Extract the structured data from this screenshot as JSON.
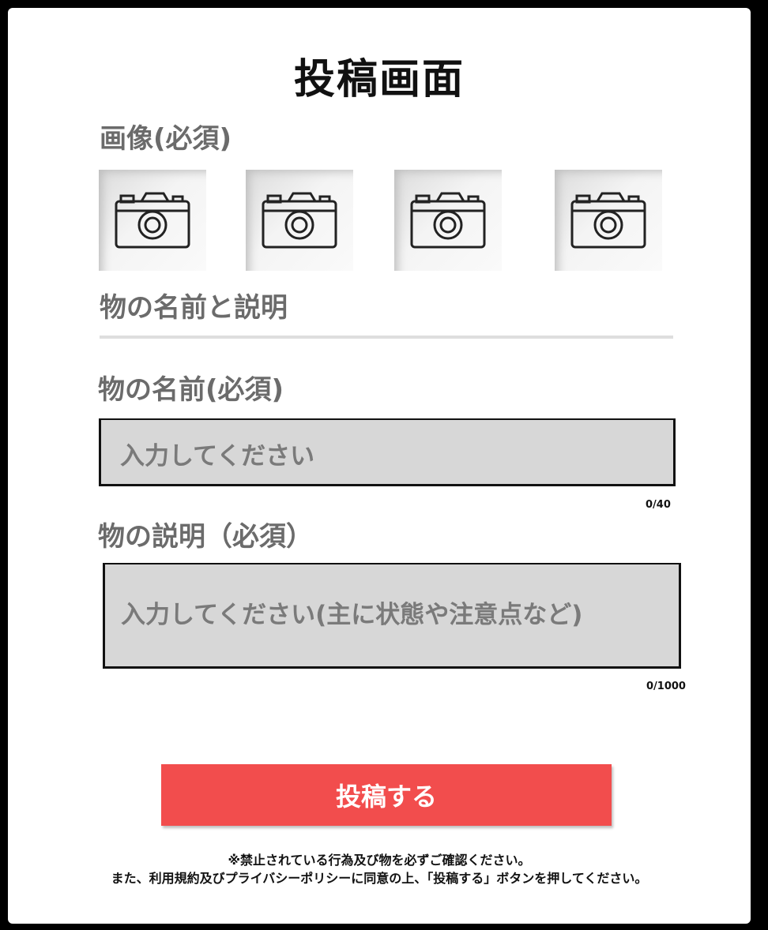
{
  "page": {
    "title": "投稿画面"
  },
  "images_section": {
    "label": "画像(必須)",
    "slots": [
      {
        "icon": "camera-icon"
      },
      {
        "icon": "camera-icon"
      },
      {
        "icon": "camera-icon"
      },
      {
        "icon": "camera-icon"
      }
    ]
  },
  "details_section": {
    "label": "物の名前と説明"
  },
  "name_field": {
    "label": "物の名前(必須)",
    "placeholder": "入力してください",
    "counter": "0/40"
  },
  "description_field": {
    "label": "物の説明（必須）",
    "placeholder": "入力してください(主に状態や注意点など)",
    "counter": "0/1000"
  },
  "submit_button": {
    "label": "投稿する",
    "color": "#f24d4d"
  },
  "notice": {
    "line1": "※禁止されている行為及び物を必ずご確認ください。",
    "line2": "また、利用規約及びプライバシーポリシーに同意の上、「投稿する」ボタンを押してください。"
  }
}
